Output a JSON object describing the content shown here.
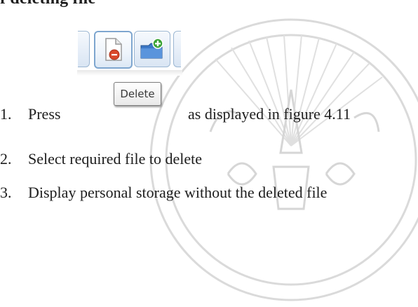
{
  "heading": {
    "text": "f deleting file"
  },
  "toolbar": {
    "delete_button": {
      "icon": "document-delete-icon"
    },
    "new_folder_button": {
      "icon": "folder-add-icon"
    }
  },
  "tooltip": {
    "label": "Delete"
  },
  "steps": [
    {
      "number": "1.",
      "text": "Press",
      "text_after": "as displayed in figure 4.11"
    },
    {
      "number": "2.",
      "text": "Select required file to delete"
    },
    {
      "number": "3.",
      "text": "Display personal storage without the deleted file"
    }
  ],
  "colors": {
    "button_border": "#7ea6cf",
    "button_fill": "#eef4fb",
    "delete_badge": "#d9482b",
    "add_badge": "#3aa335",
    "folder_blue": "#3c78c8",
    "watermark": "#d4d4d4"
  }
}
